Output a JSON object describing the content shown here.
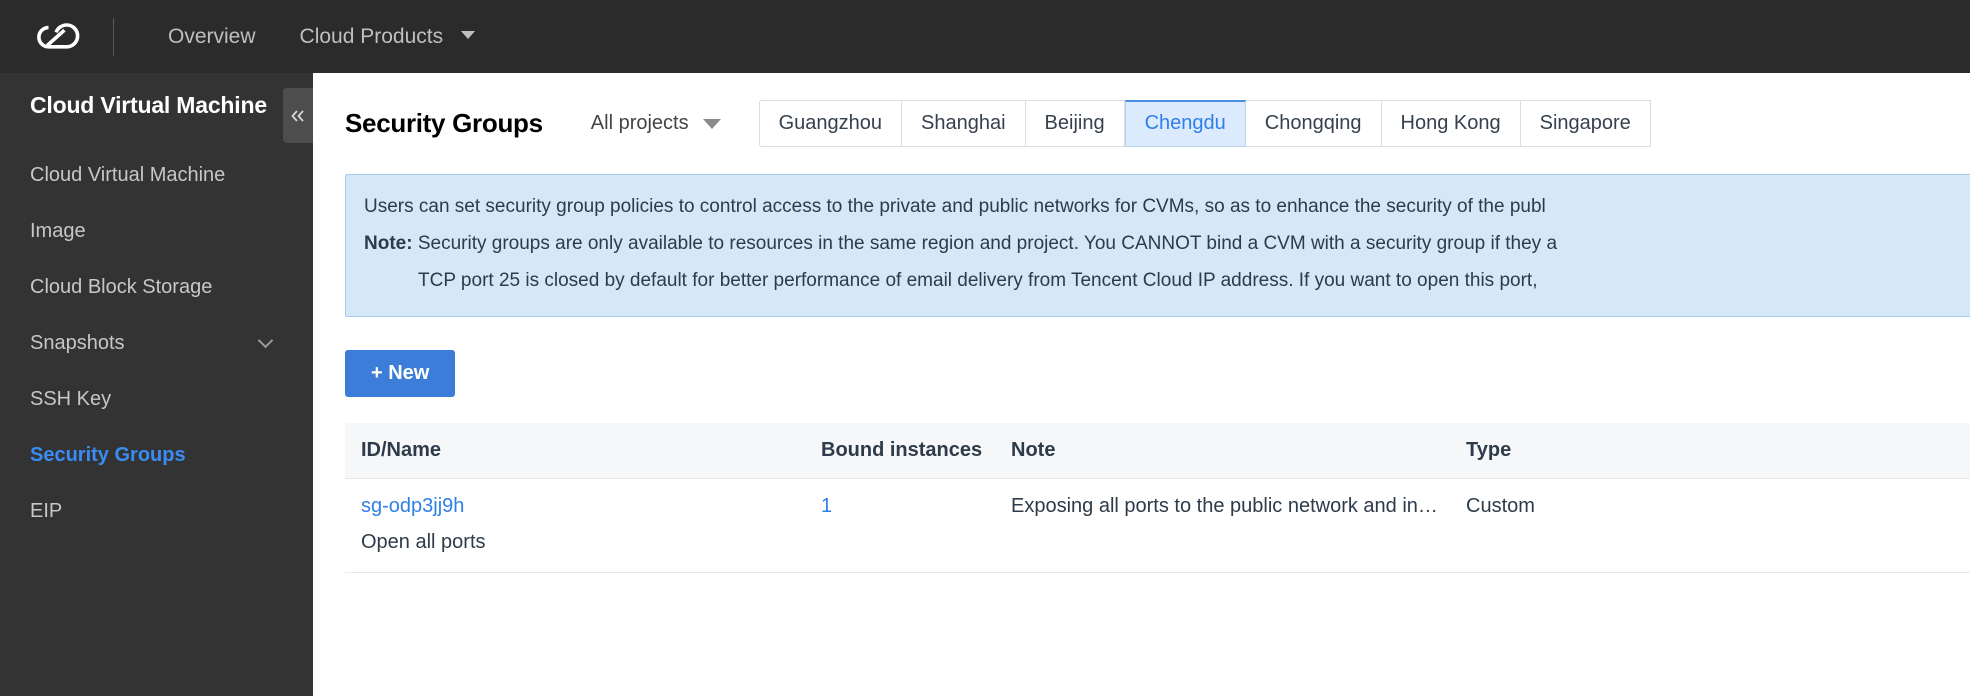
{
  "topnav": {
    "logo_icon": "tencent-cloud-logo-icon",
    "items": [
      {
        "label": "Overview",
        "has_caret": false
      },
      {
        "label": "Cloud Products",
        "has_caret": true
      }
    ]
  },
  "sidebar": {
    "title": "Cloud Virtual Machine",
    "collapse_icon": "double-chevron-left-icon",
    "items": [
      {
        "label": "Cloud Virtual Machine",
        "active": false,
        "expandable": false
      },
      {
        "label": "Image",
        "active": false,
        "expandable": false
      },
      {
        "label": "Cloud Block Storage",
        "active": false,
        "expandable": false
      },
      {
        "label": "Snapshots",
        "active": false,
        "expandable": true
      },
      {
        "label": "SSH Key",
        "active": false,
        "expandable": false
      },
      {
        "label": "Security Groups",
        "active": true,
        "expandable": false
      },
      {
        "label": "EIP",
        "active": false,
        "expandable": false
      }
    ]
  },
  "header": {
    "page_title": "Security Groups",
    "project_filter": "All projects",
    "project_caret_icon": "chevron-down-icon"
  },
  "regions": {
    "selected": "Chengdu",
    "tabs": [
      {
        "label": "Guangzhou"
      },
      {
        "label": "Shanghai"
      },
      {
        "label": "Beijing"
      },
      {
        "label": "Chengdu"
      },
      {
        "label": "Chongqing"
      },
      {
        "label": "Hong Kong"
      },
      {
        "label": "Singapore"
      }
    ]
  },
  "banner": {
    "line1": "Users can set security group policies to control access to the private and public networks for CVMs, so as to enhance the security of the publ",
    "note_label": "Note:",
    "line2": " Security groups are only available to resources in the same region and project. You CANNOT bind a CVM with a security group if they a",
    "line3": "TCP port 25 is closed by default for better performance of email delivery from Tencent Cloud IP address. If you want to open this port, "
  },
  "toolbar": {
    "new_label": "+ New"
  },
  "table": {
    "columns": [
      "ID/Name",
      "Bound instances",
      "Note",
      "Type"
    ],
    "rows": [
      {
        "id": "sg-odp3jj9h",
        "name": "Open all ports",
        "bound_instances": "1",
        "note": "Exposing all ports to the public network and in…",
        "type": "Custom"
      }
    ]
  },
  "colors": {
    "topnav_bg": "#2b2b2b",
    "sidebar_bg": "#333333",
    "accent_blue": "#2f7fe8",
    "active_link": "#3a8cf5",
    "banner_bg": "#d5e8f7",
    "banner_border": "#a9cbe8",
    "button_blue": "#3b7dd8",
    "tab_active_bg": "#dbeafd"
  }
}
